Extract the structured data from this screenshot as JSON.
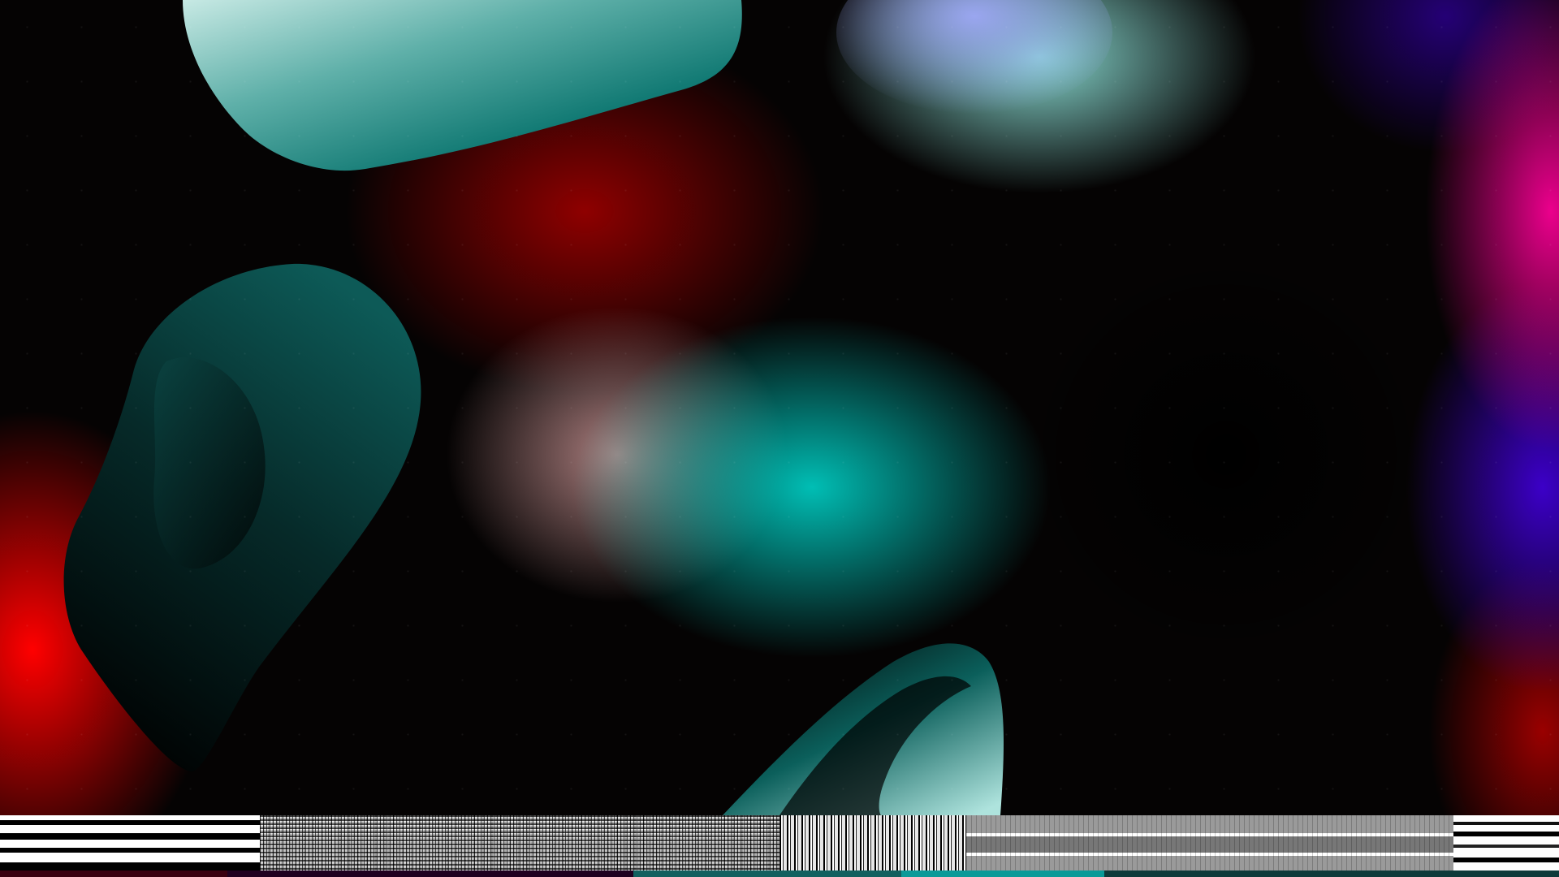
{
  "screen": {
    "kind": "desktop",
    "wallpaper": "abstract-gradient-blobs"
  },
  "taskbar": {
    "style": "garbled"
  },
  "colors": {
    "teal": "#0fb7b0",
    "red": "#ff0000",
    "magenta": "#e6008c",
    "blue": "#3c00c8",
    "black": "#000000"
  }
}
